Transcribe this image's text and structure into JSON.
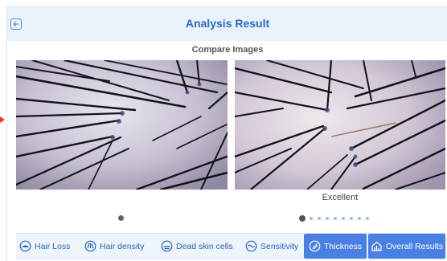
{
  "header": {
    "title": "Analysis Result"
  },
  "compare": {
    "heading": "Compare Images",
    "right_rating": "Excellent"
  },
  "pager": {
    "left_dot_count": 1,
    "right_dot_count": 9,
    "right_active_index": 0
  },
  "tabs": [
    {
      "label": "Hair Loss",
      "icon": "hair-loss-icon",
      "active": false
    },
    {
      "label": "Hair density",
      "icon": "hair-density-icon",
      "active": false
    },
    {
      "label": "Dead skin cells",
      "icon": "dead-skin-icon",
      "active": false
    },
    {
      "label": "Sensitivity",
      "icon": "sensitivity-icon",
      "active": false
    },
    {
      "label": "Thickness",
      "icon": "thickness-icon",
      "active": true
    },
    {
      "label": "Overall Results",
      "icon": "overall-results-icon",
      "active": true
    }
  ],
  "colors": {
    "accent": "#2b6cc4",
    "active_tab": "#4a7fe3",
    "header_bg": "#e9f1fb"
  }
}
